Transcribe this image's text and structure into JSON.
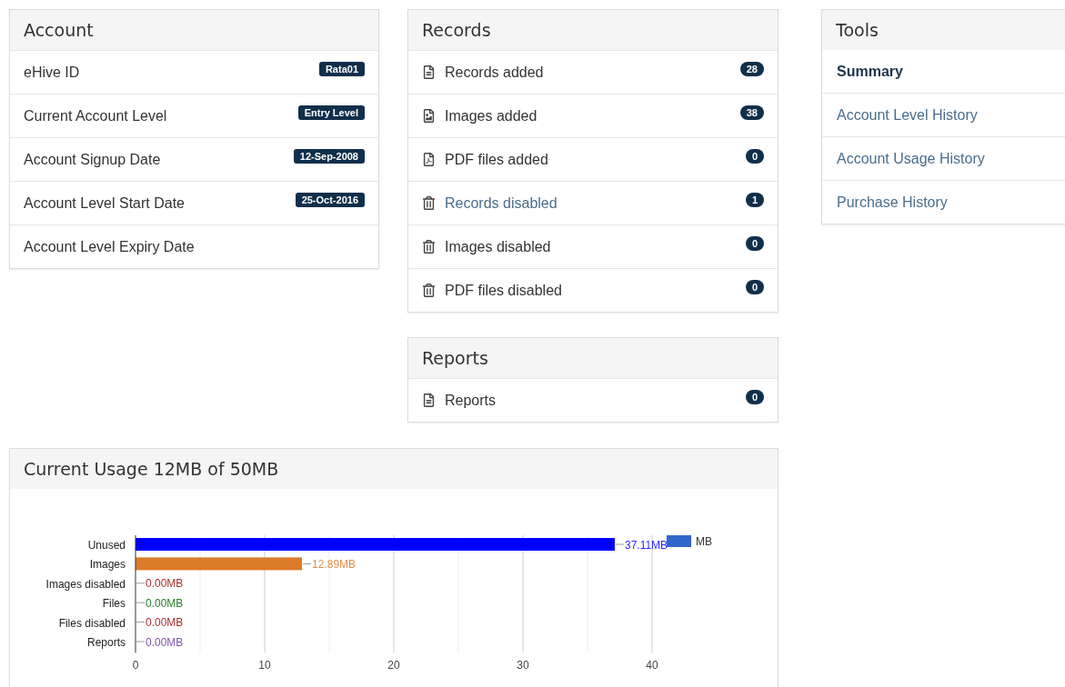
{
  "account": {
    "title": "Account",
    "rows": [
      {
        "label": "eHive ID",
        "value": "Rata01"
      },
      {
        "label": "Current Account Level",
        "value": "Entry Level"
      },
      {
        "label": "Account Signup Date",
        "value": "12-Sep-2008"
      },
      {
        "label": "Account Level Start Date",
        "value": "25-Oct-2016"
      },
      {
        "label": "Account Level Expiry Date"
      }
    ]
  },
  "records": {
    "title": "Records",
    "rows": [
      {
        "kind": "document",
        "label": "Records added",
        "count": "28",
        "link": false
      },
      {
        "kind": "image",
        "label": "Images added",
        "count": "38",
        "link": false
      },
      {
        "kind": "pdf",
        "label": "PDF files added",
        "count": "0",
        "link": false
      },
      {
        "kind": "trash",
        "label": "Records disabled",
        "count": "1",
        "link": true
      },
      {
        "kind": "trash",
        "label": "Images disabled",
        "count": "0",
        "link": false
      },
      {
        "kind": "trash",
        "label": "PDF files disabled",
        "count": "0",
        "link": false
      }
    ]
  },
  "reports": {
    "title": "Reports",
    "rows": [
      {
        "kind": "document",
        "label": "Reports",
        "count": "0",
        "link": false
      }
    ]
  },
  "tools": {
    "title": "Tools",
    "items": [
      {
        "label": "Summary",
        "selected": true
      },
      {
        "label": "Account Level History",
        "selected": false
      },
      {
        "label": "Account Usage History",
        "selected": false
      },
      {
        "label": "Purchase History",
        "selected": false
      }
    ]
  },
  "usage": {
    "title": "Current Usage 12MB of 50MB",
    "chart_data": {
      "type": "bar",
      "orientation": "horizontal",
      "categories": [
        "Unused",
        "Images",
        "Images disabled",
        "Files",
        "Files disabled",
        "Reports"
      ],
      "series": [
        {
          "name": "MB",
          "values": [
            37.11,
            12.89,
            0,
            0,
            0,
            0
          ]
        }
      ],
      "value_labels": [
        "37.11MB",
        "12.89MB",
        "0.00MB",
        "0.00MB",
        "0.00MB",
        "0.00MB"
      ],
      "grid": true,
      "xlim": [
        0,
        40
      ],
      "xticks": [
        0,
        10,
        20,
        30,
        40
      ]
    }
  }
}
